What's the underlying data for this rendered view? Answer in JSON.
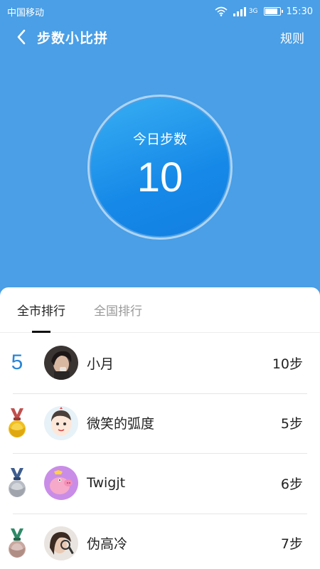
{
  "status": {
    "carrier": "中国移动",
    "network": "3G",
    "time": "15:30",
    "battery_level": 0.85
  },
  "header": {
    "title": "步数小比拼",
    "rules_label": "规则"
  },
  "today": {
    "label": "今日步数",
    "steps": "10"
  },
  "tabs": [
    {
      "label": "全市排行",
      "active": true
    },
    {
      "label": "全国排行",
      "active": false
    }
  ],
  "ranking": [
    {
      "rank": "5",
      "name": "小月",
      "score": "10步",
      "rank_type": "number"
    },
    {
      "name": "微笑的弧度",
      "score": "5步",
      "rank_type": "gold-medal"
    },
    {
      "name": "Twigjt",
      "score": "6步",
      "rank_type": "silver-medal"
    },
    {
      "name": "伪高冷",
      "score": "7步",
      "rank_type": "bronze-medal"
    }
  ],
  "colors": {
    "background": "#4a9fe6",
    "circle_fill": "#1689e8",
    "rank_number": "#2a86d8",
    "gold_medal": "#f0c020",
    "silver_medal": "#b8bcc4",
    "bronze_medal": "#c8a8a0"
  }
}
